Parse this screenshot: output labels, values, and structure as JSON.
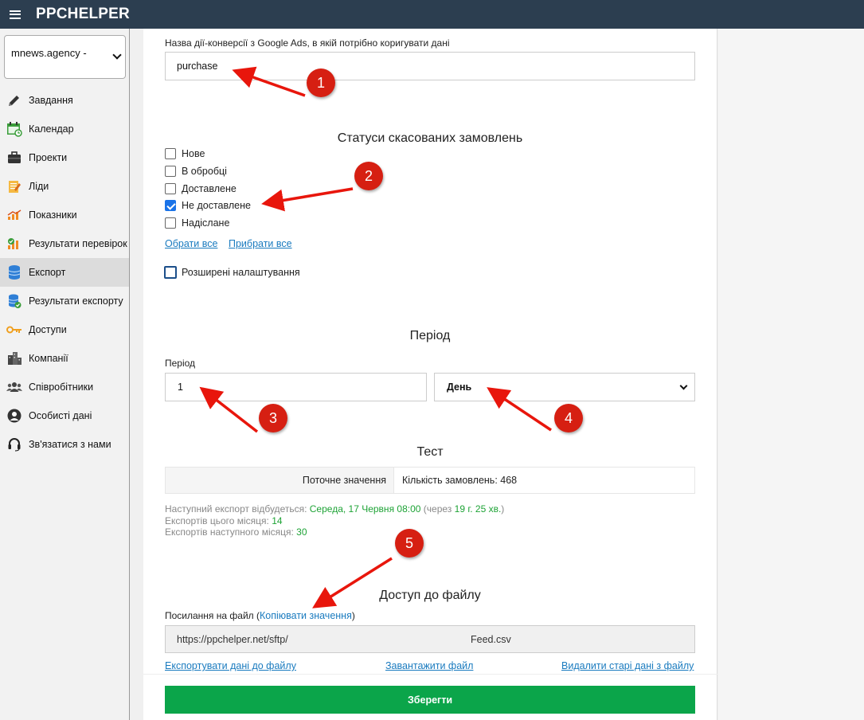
{
  "app": {
    "brand": "PPCHELPER"
  },
  "sidebar": {
    "account": "mnews.agency -",
    "items": [
      {
        "label": "Завдання",
        "icon": "pencil-icon"
      },
      {
        "label": "Календар",
        "icon": "calendar-icon"
      },
      {
        "label": "Проекти",
        "icon": "briefcase-icon"
      },
      {
        "label": "Ліди",
        "icon": "notepad-icon"
      },
      {
        "label": "Показники",
        "icon": "chart-icon"
      },
      {
        "label": "Результати перевірок",
        "icon": "check-chart-icon"
      },
      {
        "label": "Експорт",
        "icon": "database-icon",
        "active": true
      },
      {
        "label": "Результати експорту",
        "icon": "database-check-icon"
      },
      {
        "label": "Доступи",
        "icon": "key-icon"
      },
      {
        "label": "Компанії",
        "icon": "buildings-icon"
      },
      {
        "label": "Співробітники",
        "icon": "people-icon"
      },
      {
        "label": "Особисті дані",
        "icon": "user-icon"
      },
      {
        "label": "Зв'язатися з нами",
        "icon": "headset-icon"
      }
    ]
  },
  "conversion": {
    "label": "Назва дії-конверсії з Google Ads, в якій потрібно коригувати дані",
    "value": "purchase"
  },
  "statuses": {
    "title": "Статуси скасованих замовлень",
    "options": [
      {
        "label": "Нове",
        "checked": false
      },
      {
        "label": "В обробці",
        "checked": false
      },
      {
        "label": "Доставлене",
        "checked": false
      },
      {
        "label": "Не доставлене",
        "checked": true
      },
      {
        "label": "Надіслане",
        "checked": false
      }
    ],
    "select_all": "Обрати все",
    "clear_all": "Прибрати все",
    "advanced": "Розширені налаштування"
  },
  "period": {
    "title": "Період",
    "label": "Період",
    "value": "1",
    "unit": "День"
  },
  "test": {
    "title": "Тест",
    "current_label": "Поточне значення",
    "current_value": "Кількість замовлень: 468",
    "next_export_prefix": "Наступний експорт відбудеться:",
    "next_export_date": "Середа, 17 Червня 08:00",
    "next_export_in_prefix": "(через",
    "next_export_in": "19 г. 25 хв.",
    "next_export_in_suffix": ")",
    "this_month_label": "Експортів цього місяця:",
    "this_month": "14",
    "next_month_label": "Експортів наступного місяця:",
    "next_month": "30"
  },
  "file": {
    "title": "Доступ до файлу",
    "link_label": "Посилання на файл (",
    "copy_link": "Копіювати значення",
    "link_label_end": ")",
    "url_start": "https://ppchelper.net/sftp/",
    "url_end": "Feed.csv",
    "export_link": "Експортувати дані до файлу",
    "download_link": "Завантажити файл",
    "delete_link": "Видалити старі дані з файлу"
  },
  "save_button": "Зберегти",
  "annotations": [
    "1",
    "2",
    "3",
    "4",
    "5"
  ],
  "colors": {
    "topbar": "#2c3e50",
    "accent_green": "#0ba54a",
    "badge_red": "#d61f12",
    "link_blue": "#1a7bbf"
  }
}
